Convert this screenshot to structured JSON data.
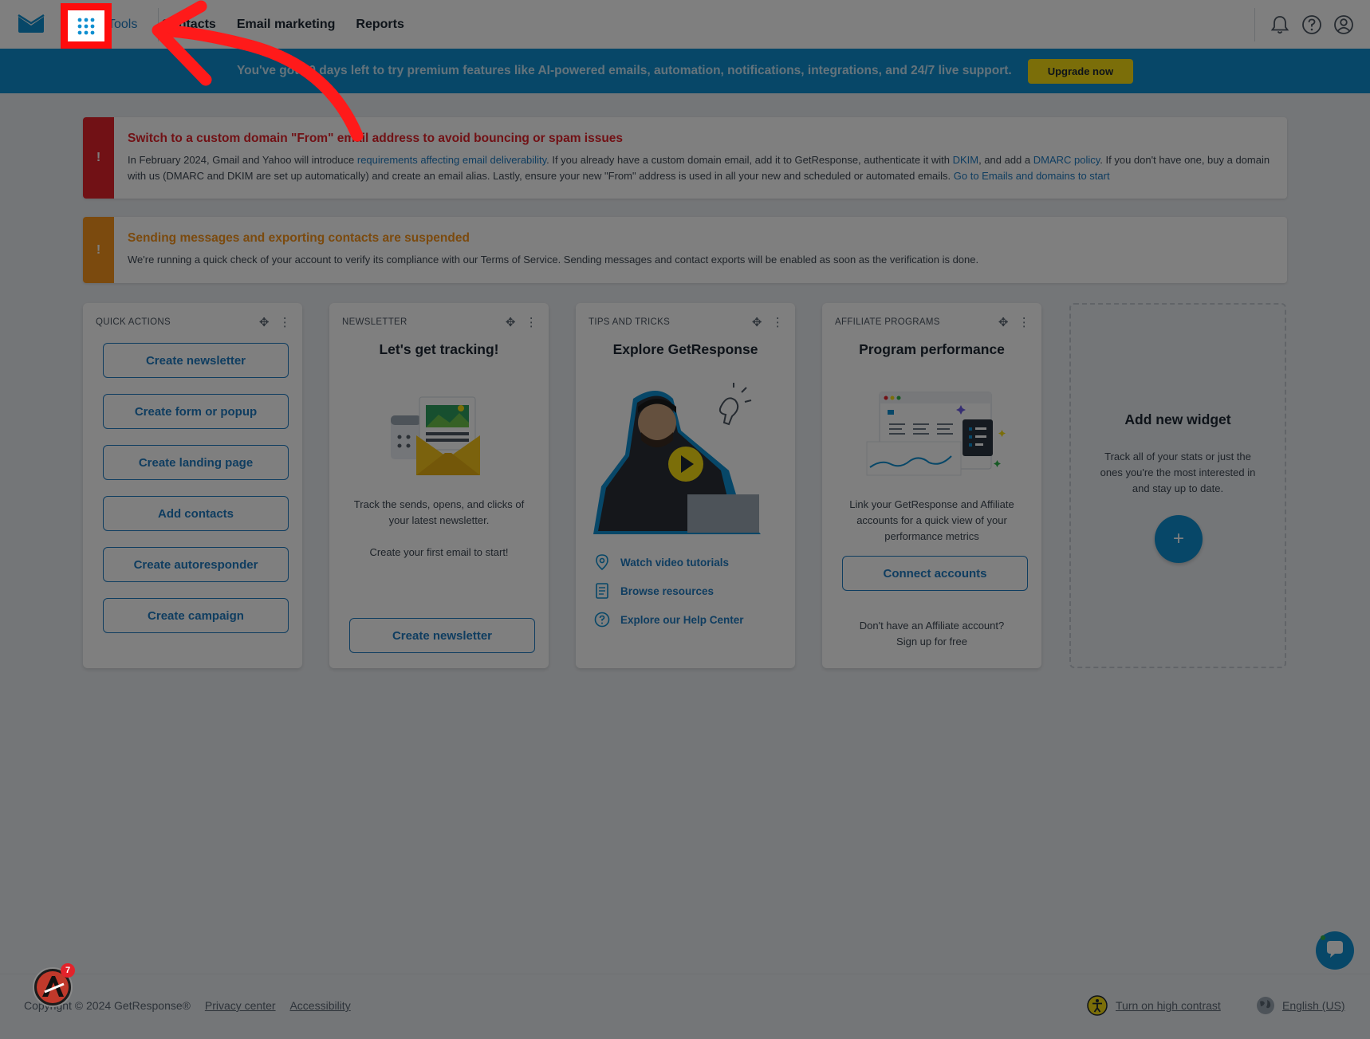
{
  "nav": {
    "items": [
      "Tools",
      "Contacts",
      "Email marketing",
      "Reports"
    ]
  },
  "banner": {
    "text": "You've got 30 days left to try premium features like AI-powered emails, automation, notifications, integrations, and 24/7 live support.",
    "button": "Upgrade now"
  },
  "alerts": {
    "domain": {
      "icon": "!",
      "title": "Switch to a custom domain \"From\" email address to avoid bouncing or spam issues",
      "text_1": "In February 2024, Gmail and Yahoo will introduce ",
      "link_1": "requirements affecting email deliverability",
      "text_2": ". If you already have a custom domain email, add it to GetResponse, authenticate it with ",
      "link_2": "DKIM",
      "text_3": ", and add a ",
      "link_3": "DMARC policy",
      "text_4": ". If you don't have one, buy a domain with us (DMARC and DKIM are set up automatically) and create an email alias. Lastly, ensure your new \"From\" address is used in all your new and scheduled or automated emails. ",
      "link_4": "Go to Emails and domains to start"
    },
    "suspended": {
      "icon": "!",
      "title": "Sending messages and exporting contacts are suspended",
      "text": "We're running a quick check of your account to verify its compliance with our Terms of Service. Sending messages and contact exports will be enabled as soon as the verification is done."
    }
  },
  "quick_actions": {
    "label": "QUICK ACTIONS",
    "buttons": [
      "Create newsletter",
      "Create form or popup",
      "Create landing page",
      "Add contacts",
      "Create autoresponder",
      "Create campaign"
    ]
  },
  "newsletter": {
    "label": "NEWSLETTER",
    "title": "Let's get tracking!",
    "text": "Track the sends, opens, and clicks of your latest newsletter.",
    "text_2": "Create your first email to start!",
    "button": "Create newsletter"
  },
  "tips": {
    "label": "TIPS AND TRICKS",
    "title": "Explore GetResponse",
    "links": [
      "Watch video tutorials",
      "Browse resources",
      "Explore our Help Center"
    ]
  },
  "affiliate": {
    "label": "AFFILIATE PROGRAMS",
    "title": "Program performance",
    "text": "Link your GetResponse and Affiliate accounts for a quick view of your performance metrics",
    "button": "Connect accounts",
    "footer_text": "Don't have an Affiliate account?",
    "footer_link": "Sign up for free"
  },
  "add_widget": {
    "title": "Add new widget",
    "text": "Track all of your stats or just the ones you're the most interested in and stay up to date.",
    "button": "+"
  },
  "footer": {
    "copyright": "Copyright © 2024 GetResponse®",
    "privacy": "Privacy center",
    "accessibility": "Accessibility",
    "contrast": "Turn on high contrast",
    "language": "English (US)"
  },
  "badge_count": "7",
  "colors": {
    "brand_blue": "#0f8fd0",
    "link_blue": "#1f7ac0",
    "upgrade_yellow": "#f7dc13",
    "alert_red": "#e3232b",
    "alert_orange": "#f7941d",
    "annotation_red": "#ff0c0c"
  }
}
